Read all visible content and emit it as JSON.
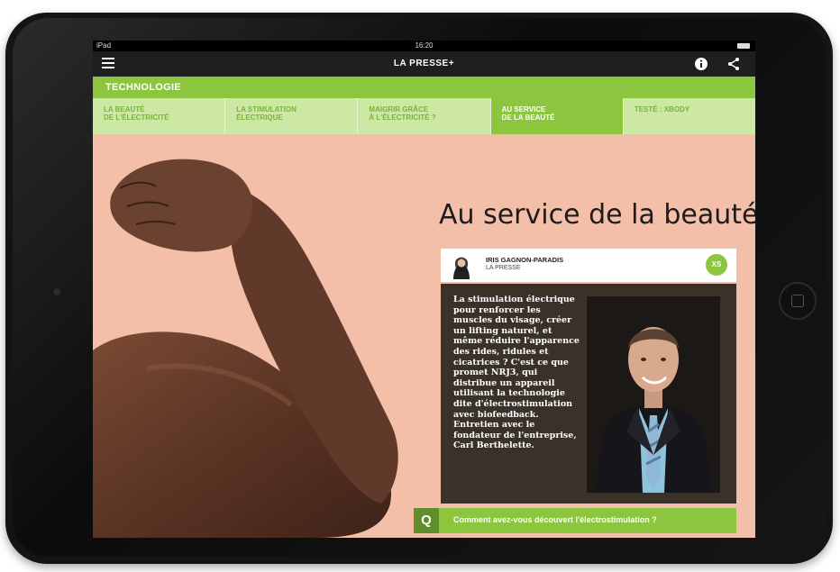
{
  "status_bar": {
    "carrier": "iPad",
    "time": "16:20"
  },
  "app_bar": {
    "logo": "LA PRESSE",
    "logo_plus": "+"
  },
  "section": {
    "title": "TECHNOLOGIE"
  },
  "subtabs": [
    {
      "line1": "LA BEAUTÉ",
      "line2": "DE L'ÉLECTRICITÉ"
    },
    {
      "line1": "LA STIMULATION",
      "line2": "ÉLECTRIQUE"
    },
    {
      "line1": "MAIGRIR GRÂCE",
      "line2": "À L'ÉLECTRICITÉ ?"
    },
    {
      "line1": "AU SERVICE",
      "line2": "DE LA BEAUTÉ"
    },
    {
      "line1": "TESTÉ : XBODY",
      "line2": ""
    }
  ],
  "article": {
    "headline": "Au service de la beauté",
    "author_name": "IRIS GAGNON-PARADIS",
    "author_org": "LA PRESSE",
    "badge": "XS",
    "lede": "La stimulation électrique pour renforcer les muscles du visage, créer un lifting naturel, et même réduire l'apparence des rides, ridules et cicatrices ? C'est ce que promet NRJ3, qui distribue un appareil utilisant la technologie dite d'électrostimulation avec biofeedback. Entretien avec le fondateur de l'entreprise, Carl Berthelette.",
    "question_marker": "Q",
    "question": "Comment avez-vous découvert l'électrostimulation ?"
  },
  "colors": {
    "accent": "#8cc63f",
    "background": "#f4bfa9",
    "dark_box": "#3a3129"
  }
}
